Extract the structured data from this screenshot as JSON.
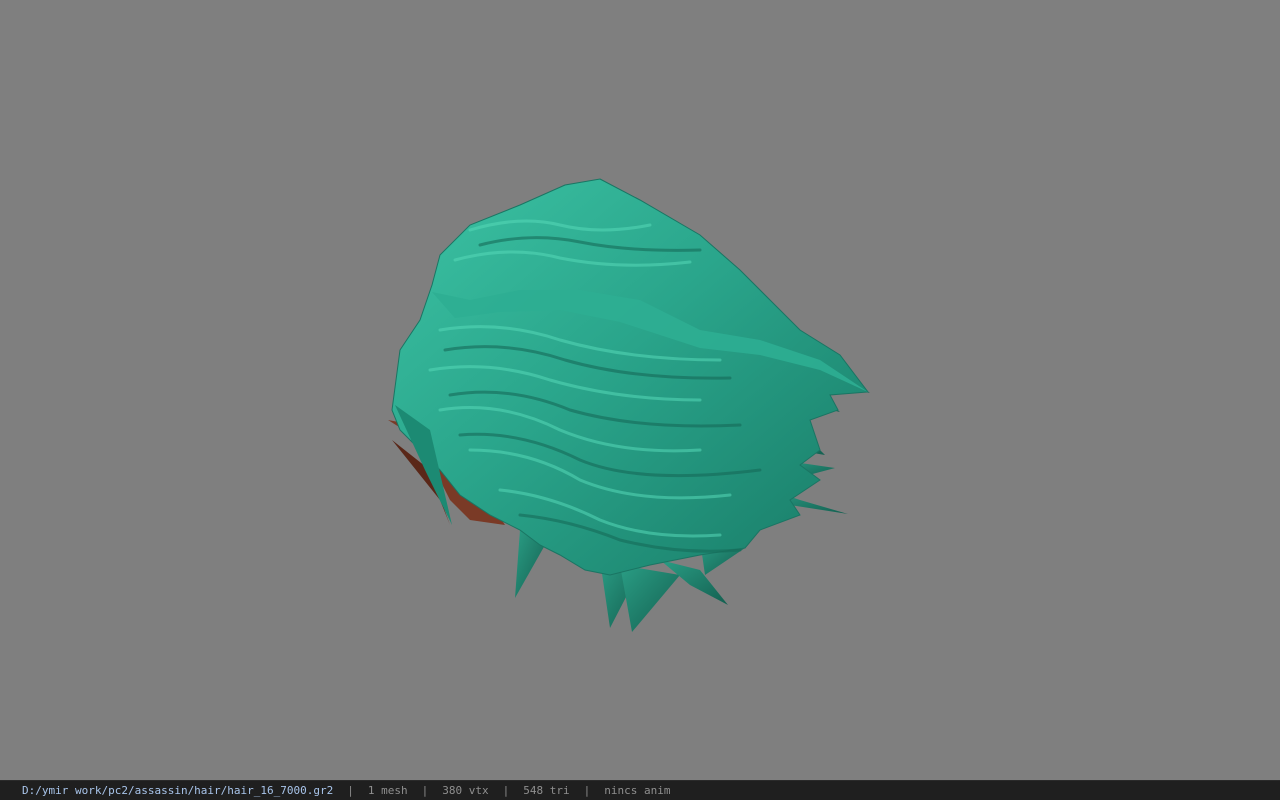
{
  "viewer": {
    "background": "#7f7f7f",
    "model_name": "hair",
    "hair_color": "#2aa58b",
    "skin_color": "#7a3a26"
  },
  "status": {
    "file_path": "D:/ymir work/pc2/assassin/hair/hair_16_7000.gr2",
    "mesh": "1 mesh",
    "vertices": "380 vtx",
    "triangles": "548 tri",
    "anim": "nincs anim",
    "separator": "|"
  }
}
